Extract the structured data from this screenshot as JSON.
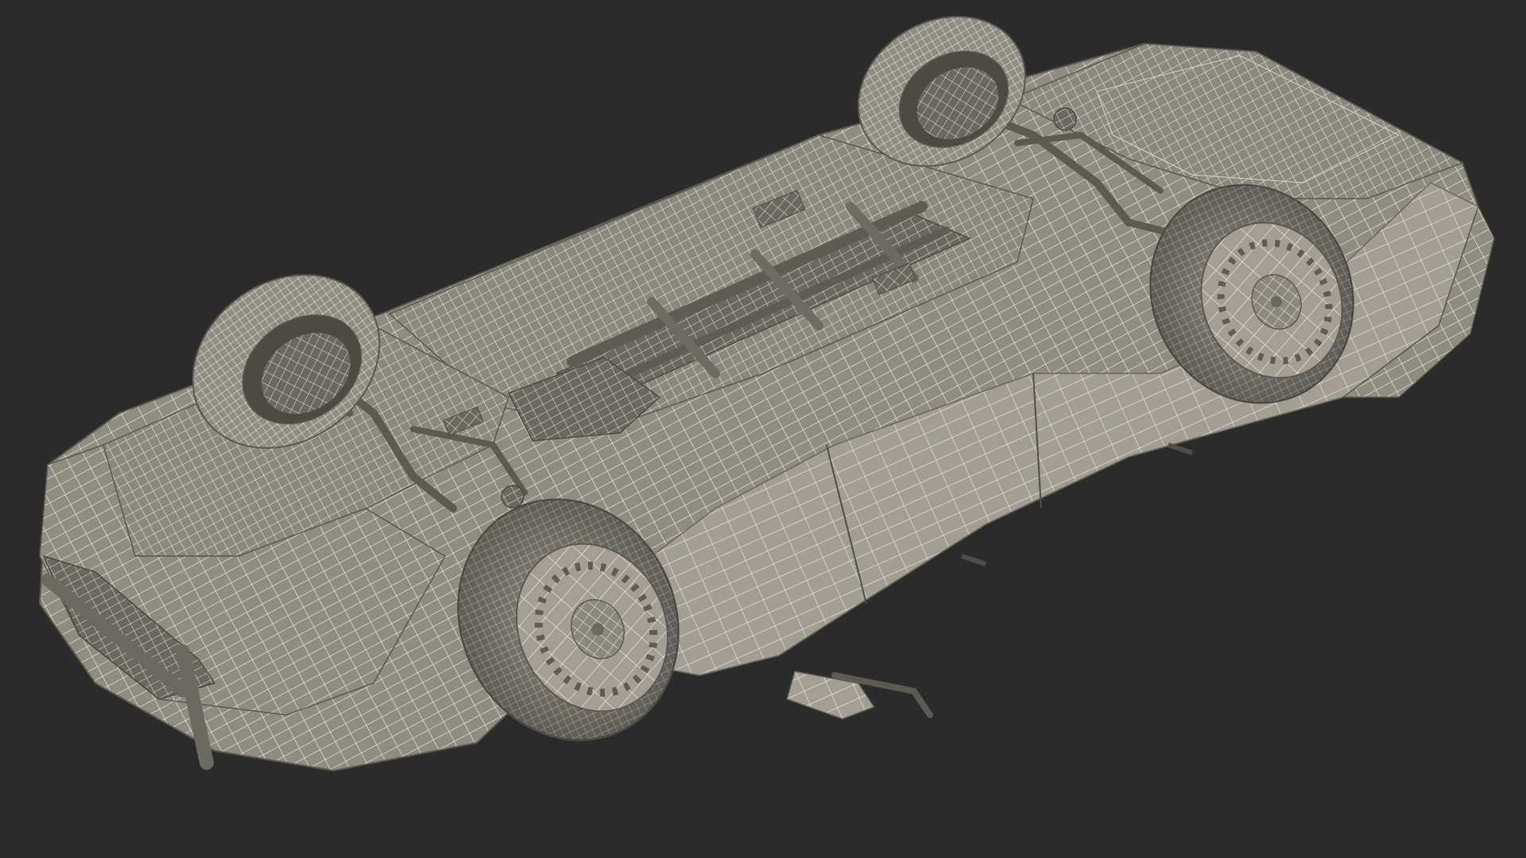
{
  "scene": {
    "background": "#2b2b2b",
    "model_fill": "#8d8b82",
    "model_fill_light": "#a9a69b",
    "model_fill_dark": "#5e5c55",
    "wire_color": "#f1eee3",
    "shadow_color": "#3a3934"
  }
}
